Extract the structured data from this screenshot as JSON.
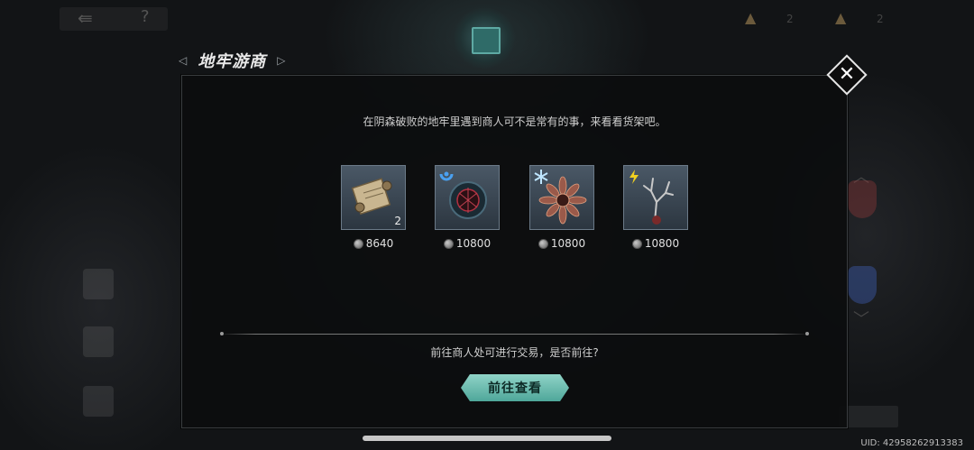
{
  "background": {
    "back_icon": "back-arrow-icon",
    "help_icon": "question-icon",
    "res_a": "2",
    "res_b": "2"
  },
  "dialog": {
    "title": "地牢游商",
    "description": "在阴森破败的地牢里遇到商人可不是常有的事，来看看货架吧。",
    "items": [
      {
        "icon": "scroll-icon",
        "count": "2",
        "price": "8640",
        "badge": ""
      },
      {
        "icon": "dark-orb-icon",
        "count": "",
        "price": "10800",
        "badge": "water-element-icon"
      },
      {
        "icon": "flower-icon",
        "count": "",
        "price": "10800",
        "badge": "ice-element-icon"
      },
      {
        "icon": "branch-icon",
        "count": "",
        "price": "10800",
        "badge": "lightning-element-icon"
      }
    ],
    "question": "前往商人处可进行交易，是否前往?",
    "go_button": "前往查看",
    "close_icon": "close-icon"
  },
  "uid": "UID: 42958262913383",
  "colors": {
    "accent": "#6fbfb2",
    "panel": "#0c0d0e"
  }
}
